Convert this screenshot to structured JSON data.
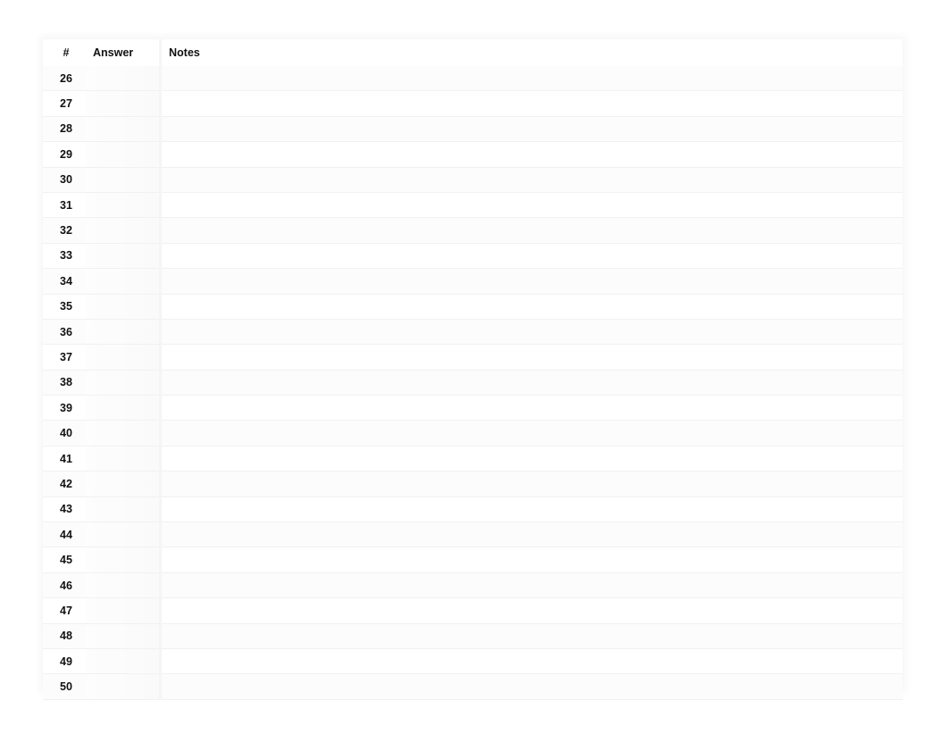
{
  "table": {
    "headers": {
      "number": "#",
      "answer": "Answer",
      "notes": "Notes"
    },
    "rows": [
      {
        "number": "26",
        "answer": "",
        "notes": ""
      },
      {
        "number": "27",
        "answer": "",
        "notes": ""
      },
      {
        "number": "28",
        "answer": "",
        "notes": ""
      },
      {
        "number": "29",
        "answer": "",
        "notes": ""
      },
      {
        "number": "30",
        "answer": "",
        "notes": ""
      },
      {
        "number": "31",
        "answer": "",
        "notes": ""
      },
      {
        "number": "32",
        "answer": "",
        "notes": ""
      },
      {
        "number": "33",
        "answer": "",
        "notes": ""
      },
      {
        "number": "34",
        "answer": "",
        "notes": ""
      },
      {
        "number": "35",
        "answer": "",
        "notes": ""
      },
      {
        "number": "36",
        "answer": "",
        "notes": ""
      },
      {
        "number": "37",
        "answer": "",
        "notes": ""
      },
      {
        "number": "38",
        "answer": "",
        "notes": ""
      },
      {
        "number": "39",
        "answer": "",
        "notes": ""
      },
      {
        "number": "40",
        "answer": "",
        "notes": ""
      },
      {
        "number": "41",
        "answer": "",
        "notes": ""
      },
      {
        "number": "42",
        "answer": "",
        "notes": ""
      },
      {
        "number": "43",
        "answer": "",
        "notes": ""
      },
      {
        "number": "44",
        "answer": "",
        "notes": ""
      },
      {
        "number": "45",
        "answer": "",
        "notes": ""
      },
      {
        "number": "46",
        "answer": "",
        "notes": ""
      },
      {
        "number": "47",
        "answer": "",
        "notes": ""
      },
      {
        "number": "48",
        "answer": "",
        "notes": ""
      },
      {
        "number": "49",
        "answer": "",
        "notes": ""
      },
      {
        "number": "50",
        "answer": "",
        "notes": ""
      }
    ]
  }
}
